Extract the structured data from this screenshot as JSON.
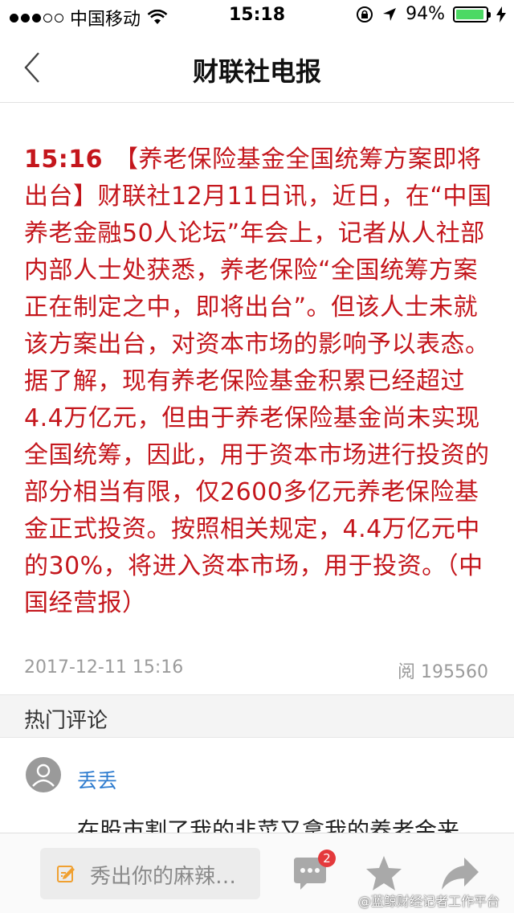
{
  "status_bar": {
    "carrier": "中国移动",
    "time": "15:18",
    "battery": "94%",
    "battery_level": 0.94
  },
  "nav": {
    "title": "财联社电报",
    "back_icon": "chevron-left-icon"
  },
  "article": {
    "time": "15:16",
    "body": "【养老保险基金全国统筹方案即将出台】财联社12月11日讯，近日，在“中国养老金融50人论坛”年会上，记者从人社部内部人士处获悉，养老保险“全国统筹方案正在制定之中，即将出台”。但该人士未就该方案出台，对资本市场的影响予以表态。据了解，现有养老保险基金积累已经超过4.4万亿元，但由于养老保险基金尚未实现全国统筹，因此，用于资本市场进行投资的部分相当有限，仅2600多亿元养老保险基金正式投资。按照相关规定，4.4万亿元中的30%，将进入资本市场，用于投资。（中国经营报）",
    "date": "2017-12-11 15:16",
    "reads": "阅 195560",
    "color": "#c4161c"
  },
  "comments": {
    "header": "热门评论",
    "items": [
      {
        "username": "丢丢",
        "text": "在股市割了我的韭菜又拿我的养老金来"
      }
    ]
  },
  "bottom_bar": {
    "input_placeholder": "秀出你的麻辣…",
    "comment_count": "2",
    "icons": [
      "pencil-icon",
      "comment-bubble-icon",
      "star-icon",
      "share-icon"
    ]
  },
  "watermark": "@蓝鲸财经记者工作平台"
}
